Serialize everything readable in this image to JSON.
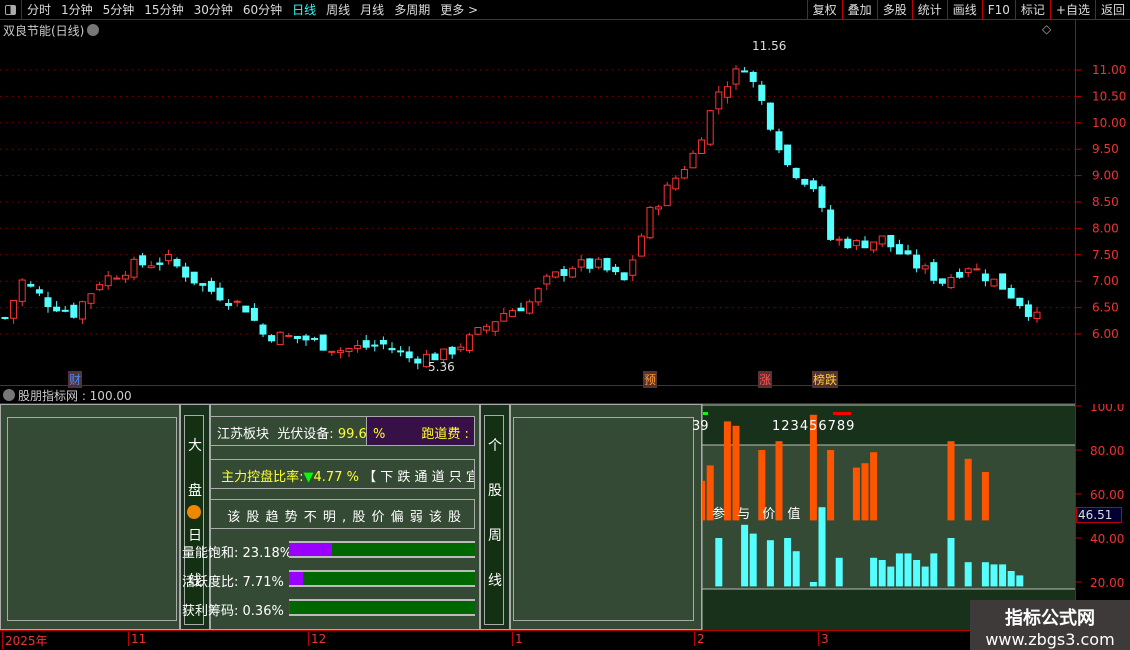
{
  "toolbar": {
    "periods": [
      "分时",
      "1分钟",
      "5分钟",
      "15分钟",
      "30分钟",
      "60分钟",
      "日线",
      "周线",
      "月线",
      "多周期",
      "更多 >"
    ],
    "active": "日线",
    "right": [
      "复权",
      "叠加",
      "多股",
      "统计",
      "画线",
      "F10",
      "标记",
      "+自选",
      "返回"
    ]
  },
  "chart": {
    "title": "双良节能(日线)",
    "high_label": "11.56",
    "low_label": "5.36",
    "price_ticks": [
      "11.00",
      "10.50",
      "10.00",
      "9.50",
      "9.00",
      "8.50",
      "8.00",
      "7.50",
      "7.00",
      "6.50",
      "6.00"
    ],
    "price_path": [
      [
        0,
        6.3
      ],
      [
        2,
        7.0
      ],
      [
        5,
        6.6
      ],
      [
        8,
        6.4
      ],
      [
        11,
        7.0
      ],
      [
        15,
        7.3
      ],
      [
        19,
        7.4
      ],
      [
        23,
        6.9
      ],
      [
        28,
        6.5
      ],
      [
        30,
        6.0
      ],
      [
        35,
        5.9
      ],
      [
        39,
        5.7
      ],
      [
        44,
        5.8
      ],
      [
        47,
        5.55
      ],
      [
        51,
        5.6
      ],
      [
        54,
        5.9
      ],
      [
        58,
        6.4
      ],
      [
        61,
        6.6
      ],
      [
        63,
        7.0
      ],
      [
        66,
        7.3
      ],
      [
        69,
        7.3
      ],
      [
        72,
        7.0
      ],
      [
        75,
        8.3
      ],
      [
        80,
        9.4
      ],
      [
        83,
        10.6
      ],
      [
        86,
        11.1
      ],
      [
        88,
        10.4
      ],
      [
        91,
        9.2
      ],
      [
        94,
        8.8
      ],
      [
        96,
        7.8
      ],
      [
        99,
        7.7
      ],
      [
        102,
        7.8
      ],
      [
        105,
        7.4
      ],
      [
        109,
        7.0
      ],
      [
        112,
        7.3
      ],
      [
        116,
        6.9
      ],
      [
        120,
        6.3
      ]
    ],
    "markers": [
      {
        "text": "财",
        "color": "#48f"
      },
      {
        "text": "预",
        "color": "#f93"
      },
      {
        "text": "涨",
        "color": "#f55"
      },
      {
        "text": "榜跌",
        "color": "#fc3"
      }
    ],
    "up_color": "#ff3333",
    "down_color": "#54ffff"
  },
  "indicator": {
    "title": "股朋指标网 : 100.00",
    "left_vertical": [
      "大",
      "盘",
      "日",
      "线"
    ],
    "right_vertical": [
      "个",
      "股",
      "周",
      "线"
    ],
    "sector": "江苏板块",
    "concept": "光伏设备",
    "score": "99.64",
    "pct": "%",
    "runway": "跑道费 :",
    "control_label": "主力控盘比率:",
    "control_value": "4.77 %",
    "control_note": "【 下 跌 通 道 只 宜 观",
    "trend_text": "该 股 趋 势 不 明 , 股 价 偏 弱 该 股",
    "trend_tail": "参 与 价 值",
    "metrics": [
      {
        "label": "量能饱和:",
        "value": "23.18%",
        "fill": 23.18
      },
      {
        "label": "活跃度比:",
        "value": "7.71%",
        "fill": 7.71
      },
      {
        "label": "获利筹码:",
        "value": "0.36%",
        "fill": 0.36
      }
    ],
    "digits_a": "39",
    "digits_b": "123456789",
    "y_ticks": [
      "100.0",
      "80.00",
      "60.00",
      "40.00",
      "20.00"
    ],
    "current": "46.51",
    "orange": [
      [
        80,
        77
      ],
      [
        81,
        66
      ],
      [
        82,
        73
      ],
      [
        84,
        93
      ],
      [
        85,
        91
      ],
      [
        88,
        80
      ],
      [
        90,
        84
      ],
      [
        94,
        96
      ],
      [
        96,
        80
      ],
      [
        99,
        72
      ],
      [
        100,
        74
      ],
      [
        101,
        79
      ],
      [
        110,
        84
      ],
      [
        112,
        76
      ],
      [
        114,
        70
      ]
    ],
    "cyan": [
      [
        83,
        40
      ],
      [
        86,
        46
      ],
      [
        87,
        42
      ],
      [
        89,
        39
      ],
      [
        91,
        40
      ],
      [
        92,
        34
      ],
      [
        94,
        20
      ],
      [
        95,
        54
      ],
      [
        97,
        31
      ],
      [
        101,
        31
      ],
      [
        102,
        30
      ],
      [
        103,
        27
      ],
      [
        104,
        33
      ],
      [
        105,
        33
      ],
      [
        106,
        30
      ],
      [
        107,
        27
      ],
      [
        108,
        33
      ],
      [
        110,
        40
      ],
      [
        112,
        29
      ],
      [
        114,
        29
      ],
      [
        115,
        28
      ],
      [
        116,
        28
      ],
      [
        117,
        25
      ],
      [
        118,
        23
      ]
    ]
  },
  "timeaxis": [
    "2025年",
    "11",
    "12",
    "1",
    "2",
    "3"
  ],
  "watermark": {
    "title": "指标公式网",
    "url": "www.zbgs3.com"
  }
}
